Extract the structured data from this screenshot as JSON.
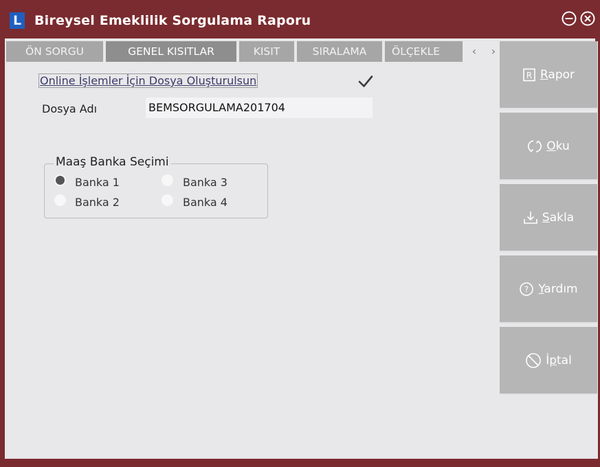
{
  "window": {
    "title": "Bireysel Emeklilik Sorgulama Raporu",
    "logo": "L"
  },
  "tabs": [
    {
      "label": "ÖN SORGU",
      "active": false
    },
    {
      "label": "GENEL KISITLAR",
      "active": true
    },
    {
      "label": "KISIT",
      "active": false
    },
    {
      "label": "SIRALAMA",
      "active": false
    },
    {
      "label": "ÖLÇEKLE",
      "active": false
    }
  ],
  "tab_scroll": {
    "left": "‹",
    "right": "›"
  },
  "form": {
    "online_checkbox_label": "Online İşlemler İçin Dosya Oluşturulsun",
    "online_checked": true,
    "file_name_label": "Dosya Adı",
    "file_name_value": "BEMSORGULAMA201704"
  },
  "bank_group": {
    "legend": "Maaş Banka Seçimi",
    "options": [
      {
        "label": "Banka 1",
        "selected": true
      },
      {
        "label": "Banka 3",
        "selected": false
      },
      {
        "label": "Banka 2",
        "selected": false
      },
      {
        "label": "Banka 4",
        "selected": false
      }
    ]
  },
  "actions": [
    {
      "first": "R",
      "rest": "apor",
      "icon": "report-icon"
    },
    {
      "first": "O",
      "rest": "ku",
      "icon": "refresh-icon"
    },
    {
      "first": "S",
      "rest": "akla",
      "icon": "download-icon"
    },
    {
      "first": "Y",
      "rest": "ardım",
      "icon": "help-icon"
    },
    {
      "first": "İ",
      "mid": "p",
      "rest": "tal",
      "icon": "cancel-icon"
    }
  ],
  "colors": {
    "window_frame": "#7a2b2f",
    "tab_bg": "#a6a6a6",
    "tab_active_bg": "#8e8e8e",
    "action_button_bg": "#b6b6b6",
    "logo_bg": "#1f5fbf"
  }
}
